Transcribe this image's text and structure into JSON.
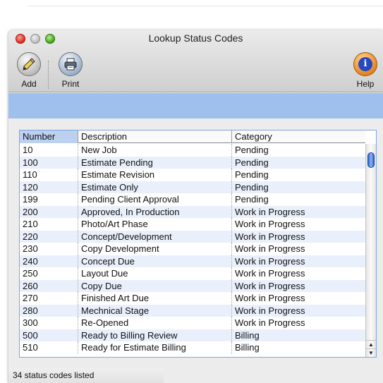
{
  "window": {
    "title": "Lookup Status Codes"
  },
  "toolbar": {
    "add_label": "Add",
    "print_label": "Print",
    "help_label": "Help",
    "help_glyph": "i",
    "icons": {
      "add": "pencil-icon",
      "print": "printer-icon",
      "help": "info-icon"
    }
  },
  "table": {
    "headers": [
      "Number",
      "Description",
      "Category"
    ],
    "rows": [
      [
        "10",
        "New Job",
        "Pending"
      ],
      [
        "100",
        "Estimate Pending",
        "Pending"
      ],
      [
        "110",
        "Estimate Revision",
        "Pending"
      ],
      [
        "120",
        "Estimate Only",
        "Pending"
      ],
      [
        "199",
        "Pending Client Approval",
        "Pending"
      ],
      [
        "200",
        "Approved, In Production",
        "Work in Progress"
      ],
      [
        "210",
        "Photo/Art Phase",
        "Work in Progress"
      ],
      [
        "220",
        "Concept/Development",
        "Work in Progress"
      ],
      [
        "230",
        "Copy Development",
        "Work in Progress"
      ],
      [
        "240",
        "Concept Due",
        "Work in Progress"
      ],
      [
        "250",
        "Layout Due",
        "Work in Progress"
      ],
      [
        "260",
        "Copy Due",
        "Work in Progress"
      ],
      [
        "270",
        "Finished Art Due",
        "Work in Progress"
      ],
      [
        "280",
        "Mechnical Stage",
        "Work in Progress"
      ],
      [
        "300",
        "Re-Opened",
        "Work in Progress"
      ],
      [
        "500",
        "Ready to Billing Review",
        "Billing"
      ],
      [
        "510",
        "Ready for Estimate Billing",
        "Billing"
      ]
    ]
  },
  "status": {
    "text": "34 status codes listed"
  },
  "colors": {
    "selected_header": "#bcd0ef",
    "alt_row": "#eaf0fb",
    "blue_bar": "#9fbfec",
    "scroll_thumb": "#2d62c6"
  }
}
